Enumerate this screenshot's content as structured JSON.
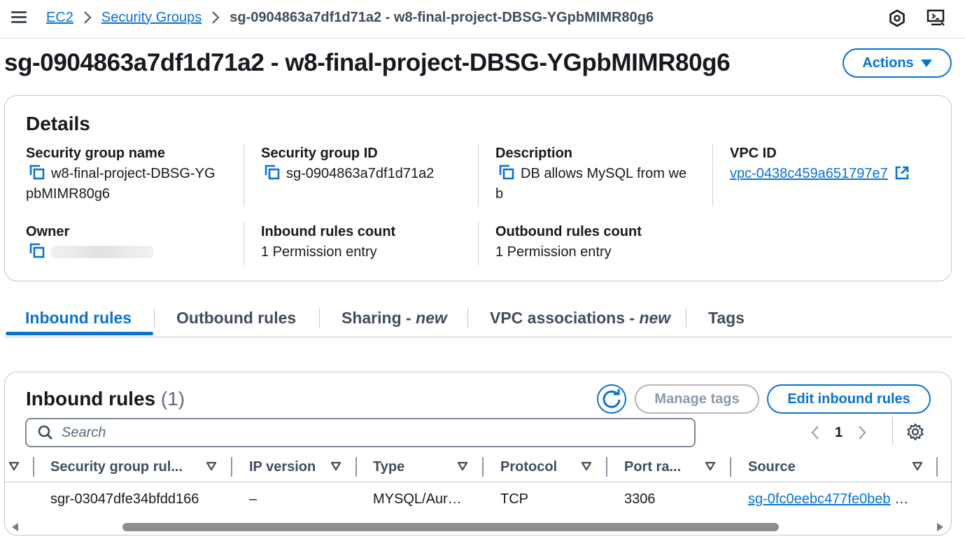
{
  "breadcrumb": {
    "items": [
      "EC2",
      "Security Groups"
    ],
    "current": "sg-0904863a7df1d71a2 - w8-final-project-DBSG-YGpbMIMR80g6"
  },
  "header": {
    "title": "sg-0904863a7df1d71a2 - w8-final-project-DBSG-YGpbMIMR80g6",
    "actions_label": "Actions"
  },
  "details": {
    "title": "Details",
    "sg_name_label": "Security group name",
    "sg_name_line1": "w8-final-project-DBSG-YG",
    "sg_name_line2": "pbMIMR80g6",
    "sg_id_label": "Security group ID",
    "sg_id": "sg-0904863a7df1d71a2",
    "description_label": "Description",
    "description_line1": "DB allows MySQL from we",
    "description_line2": "b",
    "vpc_id_label": "VPC ID",
    "vpc_id": "vpc-0438c459a651797e7",
    "owner_label": "Owner",
    "inbound_count_label": "Inbound rules count",
    "inbound_count": "1 Permission entry",
    "outbound_count_label": "Outbound rules count",
    "outbound_count": "1 Permission entry"
  },
  "tabs": {
    "inbound": "Inbound rules",
    "outbound": "Outbound rules",
    "sharing": "Sharing - ",
    "sharing_new": "new",
    "vpc_assoc": "VPC associations - ",
    "vpc_assoc_new": "new",
    "tags": "Tags"
  },
  "inbound_rules": {
    "title": "Inbound rules",
    "count": "(1)",
    "manage_tags_label": "Manage tags",
    "edit_label": "Edit inbound rules",
    "search_placeholder": "Search",
    "page": "1",
    "columns": [
      "Security group rul...",
      "IP version",
      "Type",
      "Protocol",
      "Port ra...",
      "Source"
    ],
    "rows": [
      {
        "rule_id": "sgr-03047dfe34bfdd166",
        "ip_version": "–",
        "type": "MYSQL/Aur…",
        "protocol": "TCP",
        "port_range": "3306",
        "source": "sg-0fc0eebc477fe0beb",
        "source_suffix": "…"
      }
    ]
  },
  "colors": {
    "accent": "#0972d3",
    "text": "#16191f",
    "muted": "#414d5c",
    "border": "#c6c6cd"
  }
}
